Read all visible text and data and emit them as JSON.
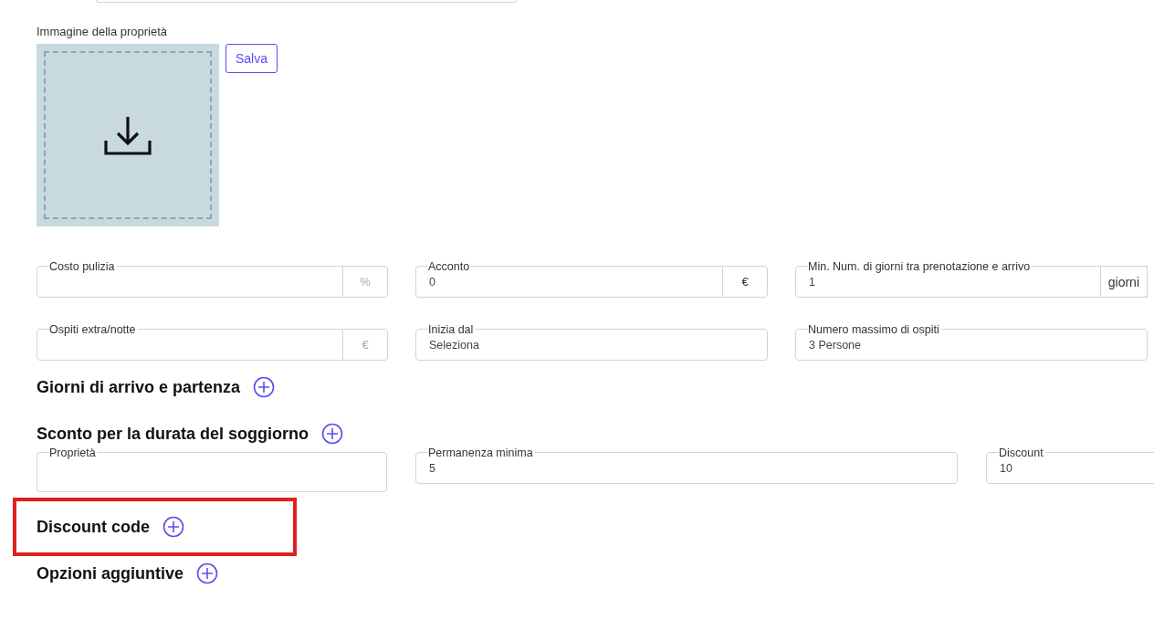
{
  "image_upload": {
    "label": "Immagine della proprietà",
    "save_button": "Salva"
  },
  "fields": [
    {
      "label": "Costo pulizia",
      "suffix": "%",
      "disabled": true
    },
    {
      "label": "Acconto",
      "value": "0",
      "suffix": "€",
      "disabled": false
    },
    {
      "label": "Min. Num. di giorni tra prenotazione e arrivo",
      "value": "1",
      "suffix": "giorni",
      "disabled": false
    },
    {
      "label": "Ospiti extra/notte",
      "suffix": "€",
      "disabled": true
    },
    {
      "label": "Inizia dal",
      "value": "Seleziona"
    },
    {
      "label": "Numero massimo di ospiti",
      "value": "3 Persone"
    }
  ],
  "sections": [
    {
      "title": "Giorni di arrivo e partenza",
      "highlighted": false
    },
    {
      "title": "Sconto per la durata del soggiorno",
      "highlighted": false,
      "fields": [
        {
          "label": "Proprietà"
        },
        {
          "label": "Permanenza minima",
          "value": "5"
        },
        {
          "label": "Discount",
          "value": "10"
        }
      ]
    },
    {
      "title": "Discount code",
      "highlighted": true
    },
    {
      "title": "Opzioni aggiuntive",
      "highlighted": false
    }
  ]
}
